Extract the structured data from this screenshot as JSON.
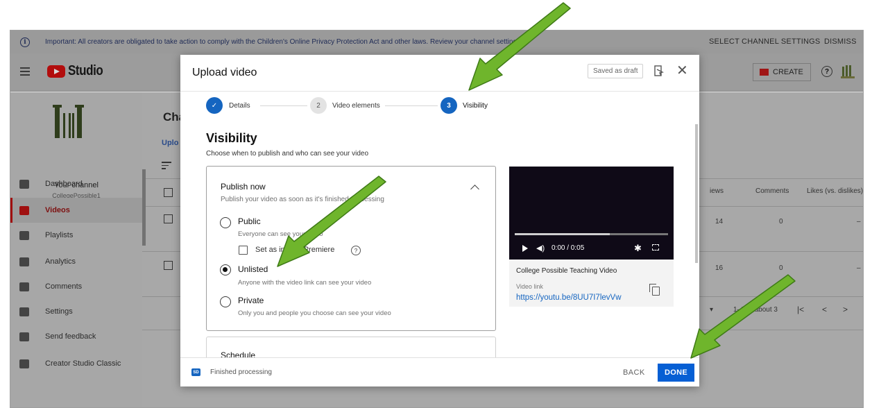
{
  "notice": {
    "text": "Important: All creators are obligated to take action to comply with the Children's Online Privacy Protection Act and other laws. Review your channel settings.",
    "select_settings": "SELECT CHANNEL SETTINGS",
    "dismiss": "DISMISS"
  },
  "header": {
    "studio": "Studio",
    "create": "CREATE"
  },
  "sidebar": {
    "channel_label": "Your channel",
    "channel_handle": "CollegePossible1",
    "items": [
      {
        "label": "Dashboard",
        "icon": "dashboard-icon",
        "active": false
      },
      {
        "label": "Videos",
        "icon": "videos-icon",
        "active": true
      },
      {
        "label": "Playlists",
        "icon": "playlists-icon",
        "active": false
      },
      {
        "label": "Analytics",
        "icon": "analytics-icon",
        "active": false
      },
      {
        "label": "Comments",
        "icon": "comments-icon",
        "active": false
      },
      {
        "label": "Settings",
        "icon": "settings-icon",
        "active": false
      },
      {
        "label": "Send feedback",
        "icon": "feedback-icon",
        "active": false
      },
      {
        "label": "Creator Studio Classic",
        "icon": "classic-icon",
        "active": false
      }
    ]
  },
  "main": {
    "title": "Cha",
    "tab": "Uplo",
    "columns": {
      "views": "iews",
      "comments": "Comments",
      "likes": "Likes (vs. dislikes)"
    },
    "rows": [
      {
        "views": "14",
        "comments": "0",
        "likes": "–"
      },
      {
        "views": "16",
        "comments": "0",
        "likes": "–"
      }
    ],
    "pagination": "1–2 of about 3"
  },
  "modal": {
    "title": "Upload video",
    "draft": "Saved as draft",
    "steps": [
      {
        "num": "✓",
        "label": "Details",
        "state": "done"
      },
      {
        "num": "2",
        "label": "Video elements",
        "state": "pending"
      },
      {
        "num": "3",
        "label": "Visibility",
        "state": "active"
      }
    ],
    "visibility_title": "Visibility",
    "visibility_sub": "Choose when to publish and who can see your video",
    "publish_now": {
      "title": "Publish now",
      "sub": "Publish your video as soon as it's finished processing"
    },
    "options": [
      {
        "label": "Public",
        "sub": "Everyone can see your video",
        "checked": false
      },
      {
        "label": "Unlisted",
        "sub": "Anyone with the video link can see your video",
        "checked": true
      },
      {
        "label": "Private",
        "sub": "Only you and people you choose can see your video",
        "checked": false
      }
    ],
    "premiere_label": "Set as instant Premiere",
    "schedule": "Schedule",
    "video": {
      "time": "0:00 / 0:05",
      "progress": 0.62,
      "name": "College Possible Teaching Video",
      "link_label": "Video link",
      "link": "https://youtu.be/8UU7I7levVw"
    },
    "footer": {
      "status": "Finished processing",
      "back": "BACK",
      "done": "DONE"
    }
  },
  "colors": {
    "accent": "#065fd4",
    "arrow": "#6fb52c"
  }
}
